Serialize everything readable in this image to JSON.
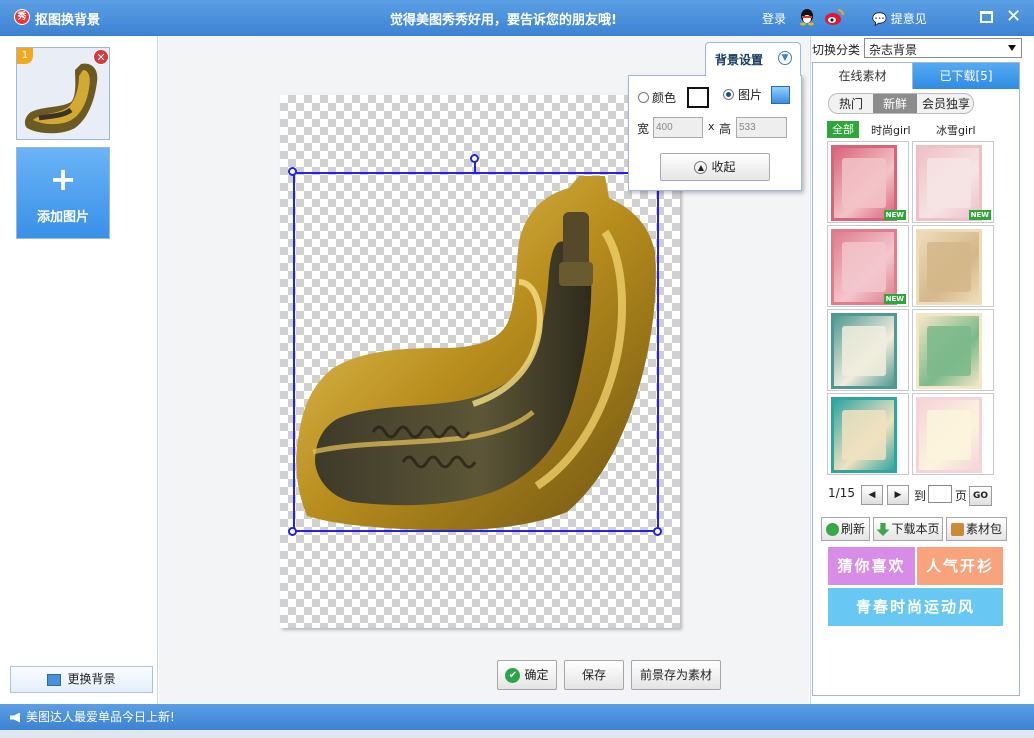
{
  "titlebar": {
    "app_icon_text": "秀",
    "app_title": "抠图换背景",
    "slogan": "觉得美图秀秀好用，要告诉您的朋友哦!",
    "login": "登录",
    "feedback": "提意见",
    "close": "✕"
  },
  "left": {
    "thumb_badge": "1",
    "add_plus": "+",
    "add_label": "添加图片",
    "change_bg_label": "更换背景"
  },
  "bg_settings": {
    "tab_label": "背景设置",
    "color_label": "颜色",
    "image_label": "图片",
    "selected_mode": "图片",
    "width_label": "宽",
    "x_label": "x",
    "height_label": "高",
    "width_value": "400",
    "height_value": "533",
    "collapse_label": "收起"
  },
  "bottom_buttons": {
    "ok": "确定",
    "save": "保存",
    "save_as_material": "前景存为素材"
  },
  "right": {
    "category_label": "切换分类",
    "category_value": "杂志背景",
    "tab_online": "在线素材",
    "tab_downloaded": "已下载[5]",
    "sort_tabs": [
      "热门",
      "新鲜",
      "会员独享"
    ],
    "sort_active": "新鲜",
    "filters": [
      "全部",
      "时尚girl",
      "冰雪girl"
    ],
    "filter_active": "全部",
    "new_tag": "NEW",
    "pager": {
      "page_info": "1/15",
      "to_label": "到",
      "page_label": "页",
      "go": "GO"
    },
    "actions": {
      "refresh": "刷新",
      "download_page": "下载本页",
      "material_pack": "素材包"
    },
    "promos": {
      "guess": "猜你喜欢",
      "popular": "人气开衫",
      "youth": "青春时尚运动风"
    },
    "thumbs": [
      {
        "name": "ice-cream-poster-1",
        "new": true,
        "colors": [
          "#d9647a",
          "#f2c3c7"
        ]
      },
      {
        "name": "ice-cream-poster-2",
        "new": true,
        "colors": [
          "#efc0c6",
          "#f6e4e4"
        ]
      },
      {
        "name": "delicious-poster",
        "new": true,
        "colors": [
          "#e07d8b",
          "#f3c6cd"
        ]
      },
      {
        "name": "beige-frame-lace",
        "new": false,
        "colors": [
          "#eedcb9",
          "#d4b78a"
        ]
      },
      {
        "name": "floral-teal-frame",
        "new": false,
        "colors": [
          "#4e9a92",
          "#f1eddd"
        ]
      },
      {
        "name": "oval-vintage-frame",
        "new": false,
        "colors": [
          "#f4e6c5",
          "#7bb98b"
        ]
      },
      {
        "name": "teal-border-frame",
        "new": false,
        "colors": [
          "#2fa5a0",
          "#f0e2c1"
        ]
      },
      {
        "name": "pink-floral-frame",
        "new": false,
        "colors": [
          "#f5d3da",
          "#fbf5dd"
        ]
      }
    ]
  },
  "status": {
    "message": "美图达人最爱单品今日上新!"
  },
  "colors": {
    "title_blue": "#3c82d3",
    "selection_blue": "#2323e6",
    "accent_green": "#2fa63a",
    "promo_purple": "#d78ce8",
    "promo_orange": "#f9a37d",
    "promo_cyan": "#69c8f3"
  }
}
